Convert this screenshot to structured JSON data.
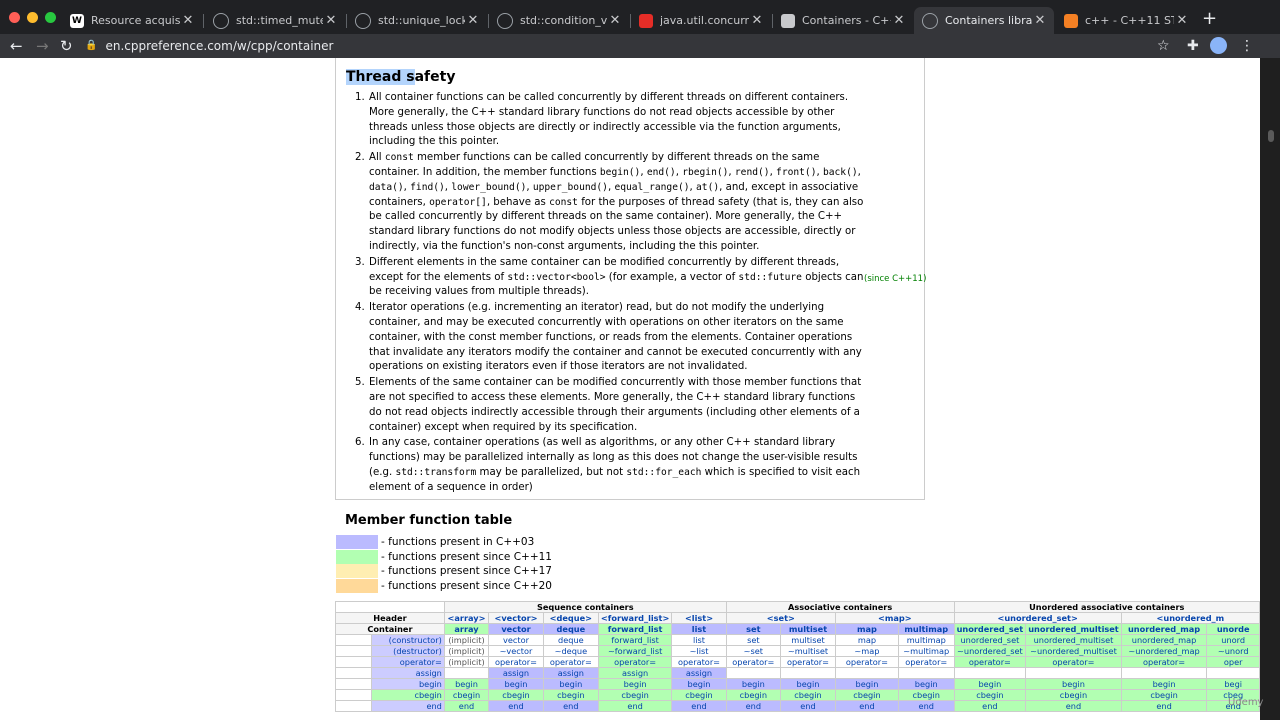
{
  "browser": {
    "tabs": [
      {
        "title": "Resource acquisition",
        "favicon": "W"
      },
      {
        "title": "std::timed_mutex - c",
        "favicon": "cpp"
      },
      {
        "title": "std::unique_lock - cp",
        "favicon": "cpp"
      },
      {
        "title": "std::condition_variab",
        "favicon": "cpp"
      },
      {
        "title": "java.util.concurrent",
        "favicon": "java"
      },
      {
        "title": "Containers - C++ Re",
        "favicon": "game"
      },
      {
        "title": "Containers library - c",
        "favicon": "cpp"
      },
      {
        "title": "c++ - C++11 STL cor",
        "favicon": "so"
      }
    ],
    "active_tab_index": 6,
    "url": "en.cppreference.com/w/cpp/container"
  },
  "thread_safety": {
    "heading_highlight": "Thread s",
    "heading_rest": "afety",
    "since_note": "(since C++11)",
    "items": [
      {
        "num": "1.",
        "parts": [
          [
            "t",
            "All container functions can be called concurrently by different threads on different containers. More generally, the C++ standard library functions do not read objects accessible by other threads unless those objects are directly or indirectly accessible via the function arguments, including the this pointer."
          ]
        ]
      },
      {
        "num": "2.",
        "parts": [
          [
            "t",
            "All "
          ],
          [
            "c",
            "const"
          ],
          [
            "t",
            " member functions can be called concurrently by different threads on the same container. In addition, the member functions "
          ],
          [
            "c",
            "begin()"
          ],
          [
            "t",
            ", "
          ],
          [
            "c",
            "end()"
          ],
          [
            "t",
            ", "
          ],
          [
            "c",
            "rbegin()"
          ],
          [
            "t",
            ", "
          ],
          [
            "c",
            "rend()"
          ],
          [
            "t",
            ", "
          ],
          [
            "c",
            "front()"
          ],
          [
            "t",
            ", "
          ],
          [
            "c",
            "back()"
          ],
          [
            "t",
            ", "
          ],
          [
            "c",
            "data()"
          ],
          [
            "t",
            ", "
          ],
          [
            "c",
            "find()"
          ],
          [
            "t",
            ", "
          ],
          [
            "c",
            "lower_bound()"
          ],
          [
            "t",
            ", "
          ],
          [
            "c",
            "upper_bound()"
          ],
          [
            "t",
            ", "
          ],
          [
            "c",
            "equal_range()"
          ],
          [
            "t",
            ", "
          ],
          [
            "c",
            "at()"
          ],
          [
            "t",
            ", and, except in associative containers, "
          ],
          [
            "c",
            "operator[]"
          ],
          [
            "t",
            ", behave as "
          ],
          [
            "c",
            "const"
          ],
          [
            "t",
            " for the purposes of thread safety (that is, they can also be called concurrently by different threads on the same container). More generally, the C++ standard library functions do not modify objects unless those objects are accessible, directly or indirectly, via the function's non-const arguments, including the this pointer."
          ]
        ]
      },
      {
        "num": "3.",
        "parts": [
          [
            "t",
            "Different elements in the same container can be modified concurrently by different threads, except for the elements of "
          ],
          [
            "c",
            "std::vector<bool>"
          ],
          [
            "t",
            " (for example, a vector of "
          ],
          [
            "c",
            "std::future"
          ],
          [
            "t",
            " objects can be receiving values from multiple threads)."
          ]
        ]
      },
      {
        "num": "4.",
        "parts": [
          [
            "t",
            "Iterator operations (e.g. incrementing an iterator) read, but do not modify the underlying container, and may be executed concurrently with operations on other iterators on the same container, with the const member functions, or reads from the elements. Container operations that invalidate any iterators modify the container and cannot be executed concurrently with any operations on existing iterators even if those iterators are not invalidated."
          ]
        ]
      },
      {
        "num": "5.",
        "parts": [
          [
            "t",
            "Elements of the same container can be modified concurrently with those member functions that are not specified to access these elements. More generally, the C++ standard library functions do not read objects indirectly accessible through their arguments (including other elements of a container) except when required by its specification."
          ]
        ]
      },
      {
        "num": "6.",
        "parts": [
          [
            "t",
            "In any case, container operations (as well as algorithms, or any other C++ standard library functions) may be parallelized internally as long as this does not change the user-visible results (e.g. "
          ],
          [
            "c",
            "std::transform"
          ],
          [
            "t",
            " may be parallelized, but not "
          ],
          [
            "c",
            "std::for_each"
          ],
          [
            "t",
            " which is specified to visit each element of a sequence in order)"
          ]
        ]
      }
    ]
  },
  "member_table": {
    "heading": "Member function table",
    "legend": [
      {
        "text": "- functions present in C++03",
        "color": "#bbbbff"
      },
      {
        "text": "- functions present since C++11",
        "color": "#b2ffb2"
      },
      {
        "text": "- functions present since C++17",
        "color": "#ffeeb2"
      },
      {
        "text": "- functions present since C++20",
        "color": "#ffd999"
      }
    ],
    "groups": [
      "Sequence containers",
      "Associative containers",
      "Unordered associative containers"
    ],
    "header_label": "Header",
    "container_label": "Container",
    "headers": [
      "<array>",
      "<vector>",
      "<deque>",
      "<forward_list>",
      "<list>",
      "<set>",
      "",
      "<map>",
      "",
      "<unordered_set>",
      "",
      "<unordered_m"
    ],
    "containers": [
      "array",
      "vector",
      "deque",
      "forward_list",
      "list",
      "set",
      "multiset",
      "map",
      "multimap",
      "unordered_set",
      "unordered_multiset",
      "unordered_map",
      "unorde"
    ],
    "rows": [
      {
        "label": "(constructor)",
        "cells": [
          "(implicit)",
          "vector",
          "deque",
          "forward_list",
          "list",
          "set",
          "multiset",
          "map",
          "multimap",
          "unordered_set",
          "unordered_multiset",
          "unordered_map",
          "unord"
        ]
      },
      {
        "label": "(destructor)",
        "cells": [
          "(implicit)",
          "~vector",
          "~deque",
          "~forward_list",
          "~list",
          "~set",
          "~multiset",
          "~map",
          "~multimap",
          "~unordered_set",
          "~unordered_multiset",
          "~unordered_map",
          "~unord"
        ]
      },
      {
        "label": "operator=",
        "cells": [
          "(implicit)",
          "operator=",
          "operator=",
          "operator=",
          "operator=",
          "operator=",
          "operator=",
          "operator=",
          "operator=",
          "operator=",
          "operator=",
          "operator=",
          "oper"
        ]
      },
      {
        "label": "assign",
        "cells": [
          "",
          "assign",
          "assign",
          "assign",
          "assign",
          "",
          "",
          "",
          "",
          "",
          "",
          "",
          ""
        ]
      },
      {
        "label": "begin",
        "cells": [
          "begin",
          "begin",
          "begin",
          "begin",
          "begin",
          "begin",
          "begin",
          "begin",
          "begin",
          "begin",
          "begin",
          "begin",
          "begi"
        ]
      },
      {
        "label": "cbegin",
        "cells": [
          "cbegin",
          "cbegin",
          "cbegin",
          "cbegin",
          "cbegin",
          "cbegin",
          "cbegin",
          "cbegin",
          "cbegin",
          "cbegin",
          "cbegin",
          "cbegin",
          "cbeg"
        ]
      },
      {
        "label": "end",
        "cells": [
          "end",
          "end",
          "end",
          "end",
          "end",
          "end",
          "end",
          "end",
          "end",
          "end",
          "end",
          "end",
          "end"
        ]
      }
    ]
  },
  "watermark": "Udemy"
}
